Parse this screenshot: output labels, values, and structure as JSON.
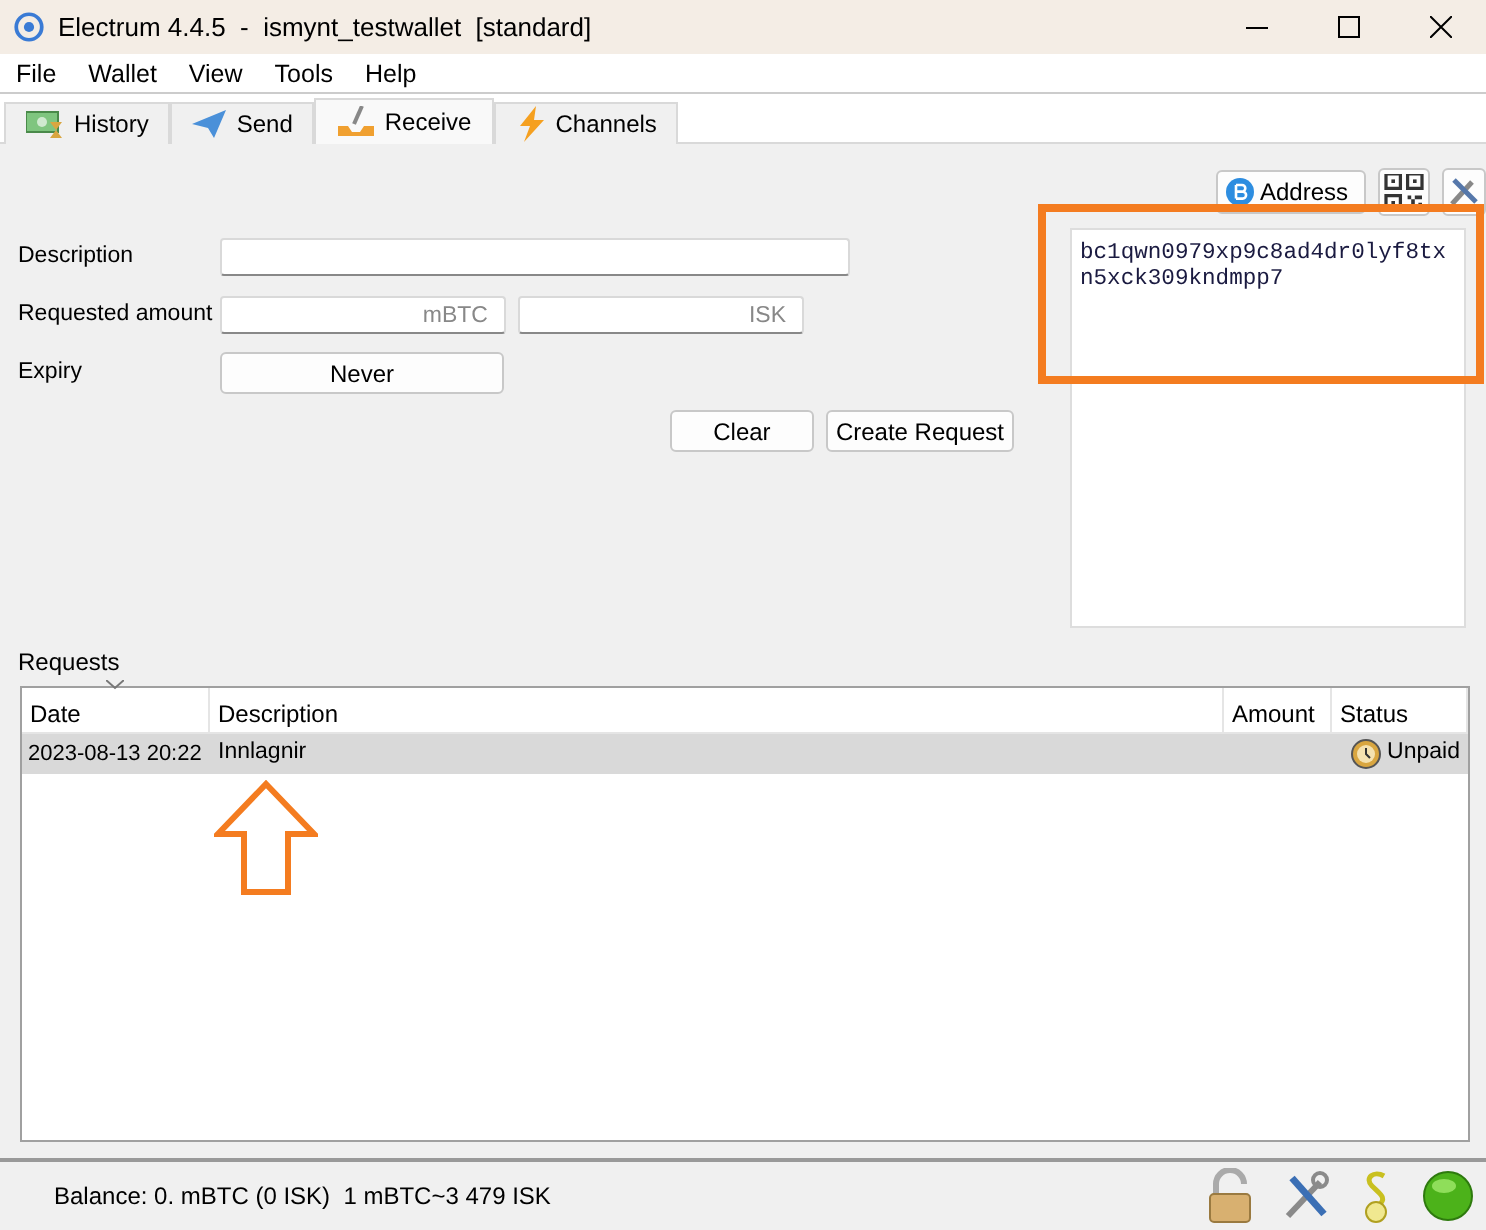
{
  "window": {
    "title": "Electrum 4.4.5  -  ismynt_testwallet  [standard]"
  },
  "menu": [
    "File",
    "Wallet",
    "View",
    "Tools",
    "Help"
  ],
  "tabs": [
    {
      "label": "History",
      "kind": "history",
      "selected": false
    },
    {
      "label": "Send",
      "kind": "send",
      "selected": false
    },
    {
      "label": "Receive",
      "kind": "receive",
      "selected": true
    },
    {
      "label": "Channels",
      "kind": "channels",
      "selected": false
    }
  ],
  "receive": {
    "description_label": "Description",
    "amount_label": "Requested amount",
    "amount_placeholder": "mBTC",
    "fiat_placeholder": "ISK",
    "expiry_label": "Expiry",
    "expiry_value": "Never",
    "buttons": [
      "Clear",
      "Create Request"
    ],
    "address_button": "Address",
    "address": "bc1qwn0979xp9c8ad4dr0lyf8txn5xck309kndmpp7"
  },
  "requests": {
    "title": "Requests",
    "columns": [
      {
        "label": "Date",
        "sorted": true
      },
      {
        "label": "Description",
        "sorted": false
      },
      {
        "label": "Amount",
        "sorted": false
      },
      {
        "label": "Status",
        "sorted": false
      }
    ],
    "rows": [
      {
        "date": "2023-08-13 20:22",
        "description": "Innlagnir",
        "status": "Unpaid",
        "selected": true
      }
    ]
  },
  "status_bar": {
    "balance": "Balance: 0. mBTC (0 ISK)  1 mBTC~3 479 ISK"
  },
  "annotations": {
    "address_frame": true,
    "row_arrow": true
  }
}
